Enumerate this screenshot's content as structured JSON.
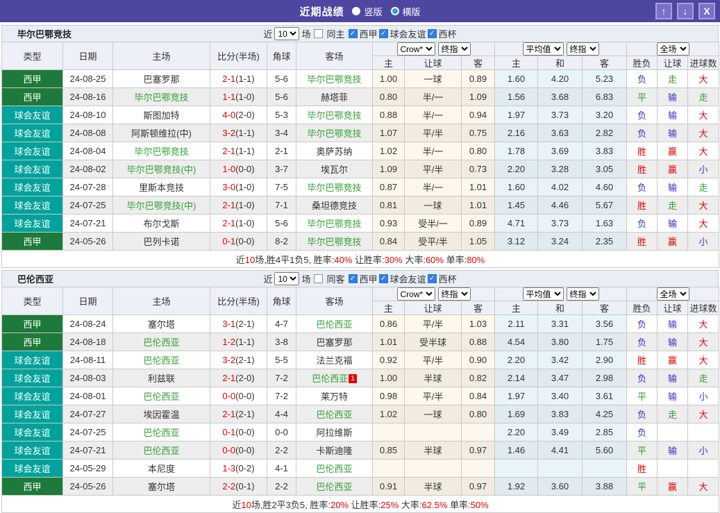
{
  "titlebar": {
    "title": "近期战绩",
    "radio_vertical": "竖版",
    "radio_horizontal": "横版",
    "selected_layout": "横版",
    "up_label": "↑",
    "down_label": "↓",
    "close_label": "X"
  },
  "colors": {
    "titlebar": "#4d47a0",
    "league_badge": "#1d7a3a",
    "friendly_badge": "#00a29b",
    "team_highlight": "#33a033",
    "win_red": "#e60000",
    "draw_green": "#2e9b31",
    "lose_blue": "#3333cc"
  },
  "controls": {
    "near": "近",
    "games": "场",
    "odds_source": "Crow*",
    "final_odds": "终指",
    "average": "平均值",
    "scope": "全场"
  },
  "cols": {
    "type": "类型",
    "date": "日期",
    "home": "主场",
    "score": "比分(半场)",
    "corner": "角球",
    "away": "客场",
    "h": "主",
    "hcap": "让球",
    "a": "客",
    "avg_h": "主",
    "avg_d": "和",
    "avg_a": "客",
    "res": "胜负",
    "res_hcap": "让球",
    "goals": "进球数"
  },
  "sections": [
    {
      "team": "毕尔巴鄂竞技",
      "filter": {
        "count": "10",
        "same_label": "同主",
        "same_cls": "",
        "leagues": [
          {
            "label": "西甲",
            "cls": "checked"
          },
          {
            "label": "球会友谊",
            "cls": "checked"
          },
          {
            "label": "西杯",
            "cls": "checked"
          }
        ]
      },
      "rows": [
        {
          "type": "西甲",
          "type_cls": "t-lg",
          "date": "24-08-25",
          "home": "巴塞罗那",
          "home_cls": "",
          "ft": "2-1",
          "ht": "(1-1)",
          "corner": "5-6",
          "away": "毕尔巴鄂竞技",
          "away_cls": "t-green",
          "badge": "",
          "h": "1.00",
          "hcap": "一球",
          "a": "0.89",
          "ah": "1.60",
          "ad": "4.20",
          "aa": "5.23",
          "r1": "负",
          "r1c": "c-blue",
          "r2": "走",
          "r2c": "c-green",
          "r3": "大",
          "r3c": "c-red"
        },
        {
          "type": "西甲",
          "type_cls": "t-lg",
          "date": "24-08-16",
          "home": "毕尔巴鄂竞技",
          "home_cls": "t-green",
          "ft": "1-1",
          "ht": "(1-0)",
          "corner": "5-6",
          "away": "赫塔菲",
          "away_cls": "",
          "badge": "",
          "h": "0.80",
          "hcap": "半/一",
          "a": "1.09",
          "ah": "1.56",
          "ad": "3.68",
          "aa": "6.83",
          "r1": "平",
          "r1c": "c-green",
          "r2": "输",
          "r2c": "c-blue",
          "r3": "走",
          "r3c": "c-green"
        },
        {
          "type": "球会友谊",
          "type_cls": "t-fr",
          "date": "24-08-10",
          "home": "斯图加特",
          "home_cls": "",
          "ft": "4-0",
          "ht": "(2-0)",
          "corner": "5-3",
          "away": "毕尔巴鄂竞技",
          "away_cls": "t-green",
          "badge": "",
          "h": "0.88",
          "hcap": "半/一",
          "a": "0.94",
          "ah": "1.97",
          "ad": "3.73",
          "aa": "3.20",
          "r1": "负",
          "r1c": "c-blue",
          "r2": "输",
          "r2c": "c-blue",
          "r3": "大",
          "r3c": "c-red"
        },
        {
          "type": "球会友谊",
          "type_cls": "t-fr",
          "date": "24-08-08",
          "home": "阿斯顿维拉(中)",
          "home_cls": "",
          "ft": "3-2",
          "ht": "(1-1)",
          "corner": "3-4",
          "away": "毕尔巴鄂竞技",
          "away_cls": "t-green",
          "badge": "",
          "h": "1.07",
          "hcap": "平/半",
          "a": "0.75",
          "ah": "2.16",
          "ad": "3.63",
          "aa": "2.82",
          "r1": "负",
          "r1c": "c-blue",
          "r2": "输",
          "r2c": "c-blue",
          "r3": "大",
          "r3c": "c-red"
        },
        {
          "type": "球会友谊",
          "type_cls": "t-fr",
          "date": "24-08-04",
          "home": "毕尔巴鄂竞技",
          "home_cls": "t-green",
          "ft": "2-1",
          "ht": "(1-1)",
          "corner": "2-1",
          "away": "奥萨苏纳",
          "away_cls": "",
          "badge": "",
          "h": "1.02",
          "hcap": "半/一",
          "a": "0.80",
          "ah": "1.78",
          "ad": "3.69",
          "aa": "3.83",
          "r1": "胜",
          "r1c": "c-red",
          "r2": "赢",
          "r2c": "c-red",
          "r3": "大",
          "r3c": "c-red"
        },
        {
          "type": "球会友谊",
          "type_cls": "t-fr",
          "date": "24-08-02",
          "home": "毕尔巴鄂竞技(中)",
          "home_cls": "t-green",
          "ft": "1-0",
          "ht": "(0-0)",
          "corner": "3-7",
          "away": "埃瓦尔",
          "away_cls": "",
          "badge": "",
          "h": "1.09",
          "hcap": "平/半",
          "a": "0.73",
          "ah": "2.20",
          "ad": "3.28",
          "aa": "3.05",
          "r1": "胜",
          "r1c": "c-red",
          "r2": "赢",
          "r2c": "c-red",
          "r3": "小",
          "r3c": "c-blue"
        },
        {
          "type": "球会友谊",
          "type_cls": "t-fr",
          "date": "24-07-28",
          "home": "里斯本竞技",
          "home_cls": "",
          "ft": "3-0",
          "ht": "(1-0)",
          "corner": "7-5",
          "away": "毕尔巴鄂竞技",
          "away_cls": "t-green",
          "badge": "",
          "h": "0.87",
          "hcap": "半/一",
          "a": "1.01",
          "ah": "1.60",
          "ad": "4.02",
          "aa": "4.60",
          "r1": "负",
          "r1c": "c-blue",
          "r2": "输",
          "r2c": "c-blue",
          "r3": "走",
          "r3c": "c-green"
        },
        {
          "type": "球会友谊",
          "type_cls": "t-fr",
          "date": "24-07-25",
          "home": "毕尔巴鄂竞技(中)",
          "home_cls": "t-green",
          "ft": "2-1",
          "ht": "(1-0)",
          "corner": "7-1",
          "away": "桑坦德竞技",
          "away_cls": "",
          "badge": "",
          "h": "0.81",
          "hcap": "一球",
          "a": "1.01",
          "ah": "1.45",
          "ad": "4.46",
          "aa": "5.67",
          "r1": "胜",
          "r1c": "c-red",
          "r2": "走",
          "r2c": "c-green",
          "r3": "大",
          "r3c": "c-red"
        },
        {
          "type": "球会友谊",
          "type_cls": "t-fr",
          "date": "24-07-21",
          "home": "布尔戈斯",
          "home_cls": "",
          "ft": "2-1",
          "ht": "(1-0)",
          "corner": "5-6",
          "away": "毕尔巴鄂竞技",
          "away_cls": "t-green",
          "badge": "",
          "h": "0.93",
          "hcap": "受半/一",
          "a": "0.89",
          "ah": "4.71",
          "ad": "3.73",
          "aa": "1.63",
          "r1": "负",
          "r1c": "c-blue",
          "r2": "输",
          "r2c": "c-blue",
          "r3": "大",
          "r3c": "c-red"
        },
        {
          "type": "西甲",
          "type_cls": "t-lg",
          "date": "24-05-26",
          "home": "巴列卡诺",
          "home_cls": "",
          "ft": "0-1",
          "ht": "(0-0)",
          "corner": "8-2",
          "away": "毕尔巴鄂竞技",
          "away_cls": "t-green",
          "badge": "",
          "h": "0.84",
          "hcap": "受平/半",
          "a": "1.05",
          "ah": "3.12",
          "ad": "3.24",
          "aa": "2.35",
          "r1": "胜",
          "r1c": "c-red",
          "r2": "赢",
          "r2c": "c-red",
          "r3": "小",
          "r3c": "c-blue"
        }
      ],
      "summary": [
        {
          "text": "近"
        },
        {
          "text": "10",
          "cls": "c-red"
        },
        {
          "text": "场,胜4平1负5, 胜率:"
        },
        {
          "text": "40%",
          "cls": "c-red"
        },
        {
          "text": " 让胜率:"
        },
        {
          "text": "30%",
          "cls": "c-red"
        },
        {
          "text": " 大率:"
        },
        {
          "text": "60%",
          "cls": "c-red"
        },
        {
          "text": " 单率:"
        },
        {
          "text": "80%",
          "cls": "c-red"
        }
      ]
    },
    {
      "team": "巴伦西亚",
      "filter": {
        "count": "10",
        "same_label": "同客",
        "same_cls": "",
        "leagues": [
          {
            "label": "西甲",
            "cls": "checked"
          },
          {
            "label": "球会友谊",
            "cls": "checked"
          },
          {
            "label": "西杯",
            "cls": "checked"
          }
        ]
      },
      "rows": [
        {
          "type": "西甲",
          "type_cls": "t-lg",
          "date": "24-08-24",
          "home": "塞尔塔",
          "home_cls": "",
          "ft": "3-1",
          "ht": "(2-1)",
          "corner": "4-7",
          "away": "巴伦西亚",
          "away_cls": "t-green",
          "badge": "",
          "h": "0.86",
          "hcap": "平/半",
          "a": "1.03",
          "ah": "2.11",
          "ad": "3.31",
          "aa": "3.56",
          "r1": "负",
          "r1c": "c-blue",
          "r2": "输",
          "r2c": "c-blue",
          "r3": "大",
          "r3c": "c-red"
        },
        {
          "type": "西甲",
          "type_cls": "t-lg",
          "date": "24-08-18",
          "home": "巴伦西亚",
          "home_cls": "t-green",
          "ft": "1-2",
          "ht": "(1-1)",
          "corner": "3-8",
          "away": "巴塞罗那",
          "away_cls": "",
          "badge": "",
          "h": "1.01",
          "hcap": "受半球",
          "a": "0.88",
          "ah": "4.54",
          "ad": "3.80",
          "aa": "1.75",
          "r1": "负",
          "r1c": "c-blue",
          "r2": "输",
          "r2c": "c-blue",
          "r3": "大",
          "r3c": "c-red"
        },
        {
          "type": "球会友谊",
          "type_cls": "t-fr",
          "date": "24-08-11",
          "home": "巴伦西亚",
          "home_cls": "t-green",
          "ft": "3-2",
          "ht": "(2-1)",
          "corner": "5-5",
          "away": "法兰克福",
          "away_cls": "",
          "badge": "",
          "h": "0.92",
          "hcap": "平/半",
          "a": "0.90",
          "ah": "2.20",
          "ad": "3.42",
          "aa": "2.90",
          "r1": "胜",
          "r1c": "c-red",
          "r2": "赢",
          "r2c": "c-red",
          "r3": "大",
          "r3c": "c-red"
        },
        {
          "type": "球会友谊",
          "type_cls": "t-fr",
          "date": "24-08-03",
          "home": "利兹联",
          "home_cls": "",
          "ft": "2-1",
          "ht": "(2-0)",
          "corner": "7-2",
          "away": "巴伦西亚",
          "away_cls": "t-green",
          "badge": "1",
          "h": "1.00",
          "hcap": "半球",
          "a": "0.82",
          "ah": "2.14",
          "ad": "3.47",
          "aa": "2.98",
          "r1": "负",
          "r1c": "c-blue",
          "r2": "输",
          "r2c": "c-blue",
          "r3": "走",
          "r3c": "c-green"
        },
        {
          "type": "球会友谊",
          "type_cls": "t-fr",
          "date": "24-08-01",
          "home": "巴伦西亚",
          "home_cls": "t-green",
          "ft": "0-0",
          "ht": "(0-0)",
          "corner": "7-2",
          "away": "莱万特",
          "away_cls": "",
          "badge": "",
          "h": "0.98",
          "hcap": "平/半",
          "a": "0.84",
          "ah": "1.97",
          "ad": "3.40",
          "aa": "3.61",
          "r1": "平",
          "r1c": "c-green",
          "r2": "输",
          "r2c": "c-blue",
          "r3": "小",
          "r3c": "c-blue"
        },
        {
          "type": "球会友谊",
          "type_cls": "t-fr",
          "date": "24-07-27",
          "home": "埃因霍温",
          "home_cls": "",
          "ft": "2-1",
          "ht": "(2-1)",
          "corner": "4-4",
          "away": "巴伦西亚",
          "away_cls": "t-green",
          "badge": "",
          "h": "1.02",
          "hcap": "一球",
          "a": "0.80",
          "ah": "1.69",
          "ad": "3.83",
          "aa": "4.25",
          "r1": "负",
          "r1c": "c-blue",
          "r2": "走",
          "r2c": "c-green",
          "r3": "大",
          "r3c": "c-red"
        },
        {
          "type": "球会友谊",
          "type_cls": "t-fr",
          "date": "24-07-25",
          "home": "巴伦西亚",
          "home_cls": "t-green",
          "ft": "0-1",
          "ht": "(0-0)",
          "corner": "0-0",
          "away": "阿拉维斯",
          "away_cls": "",
          "badge": "",
          "h": "",
          "hcap": "",
          "a": "",
          "ah": "2.20",
          "ad": "3.49",
          "aa": "2.85",
          "r1": "负",
          "r1c": "c-blue",
          "r2": "",
          "r2c": "",
          "r3": "",
          "r3c": ""
        },
        {
          "type": "球会友谊",
          "type_cls": "t-fr",
          "date": "24-07-21",
          "home": "巴伦西亚",
          "home_cls": "t-green",
          "ft": "0-0",
          "ht": "(0-0)",
          "corner": "2-2",
          "away": "卡斯迪隆",
          "away_cls": "",
          "badge": "",
          "h": "0.85",
          "hcap": "半球",
          "a": "0.97",
          "ah": "1.46",
          "ad": "4.41",
          "aa": "5.60",
          "r1": "平",
          "r1c": "c-green",
          "r2": "输",
          "r2c": "c-blue",
          "r3": "小",
          "r3c": "c-blue"
        },
        {
          "type": "球会友谊",
          "type_cls": "t-fr",
          "date": "24-05-29",
          "home": "本尼度",
          "home_cls": "",
          "ft": "1-3",
          "ht": "(0-2)",
          "corner": "4-1",
          "away": "巴伦西亚",
          "away_cls": "t-green",
          "badge": "",
          "h": "",
          "hcap": "",
          "a": "",
          "ah": "",
          "ad": "",
          "aa": "",
          "r1": "胜",
          "r1c": "c-red",
          "r2": "",
          "r2c": "",
          "r3": "",
          "r3c": ""
        },
        {
          "type": "西甲",
          "type_cls": "t-lg",
          "date": "24-05-26",
          "home": "塞尔塔",
          "home_cls": "",
          "ft": "2-2",
          "ht": "(0-1)",
          "corner": "2-2",
          "away": "巴伦西亚",
          "away_cls": "t-green",
          "badge": "",
          "h": "0.91",
          "hcap": "半球",
          "a": "0.97",
          "ah": "1.92",
          "ad": "3.60",
          "aa": "3.88",
          "r1": "平",
          "r1c": "c-green",
          "r2": "赢",
          "r2c": "c-red",
          "r3": "大",
          "r3c": "c-red"
        }
      ],
      "summary": [
        {
          "text": "近"
        },
        {
          "text": "10",
          "cls": "c-red"
        },
        {
          "text": "场,胜2平3负5, 胜率:"
        },
        {
          "text": "20%",
          "cls": "c-red"
        },
        {
          "text": " 让胜率:"
        },
        {
          "text": "25%",
          "cls": "c-red"
        },
        {
          "text": " 大率:"
        },
        {
          "text": "62.5%",
          "cls": "c-red"
        },
        {
          "text": " 单率:"
        },
        {
          "text": "50%",
          "cls": "c-red"
        }
      ]
    }
  ]
}
